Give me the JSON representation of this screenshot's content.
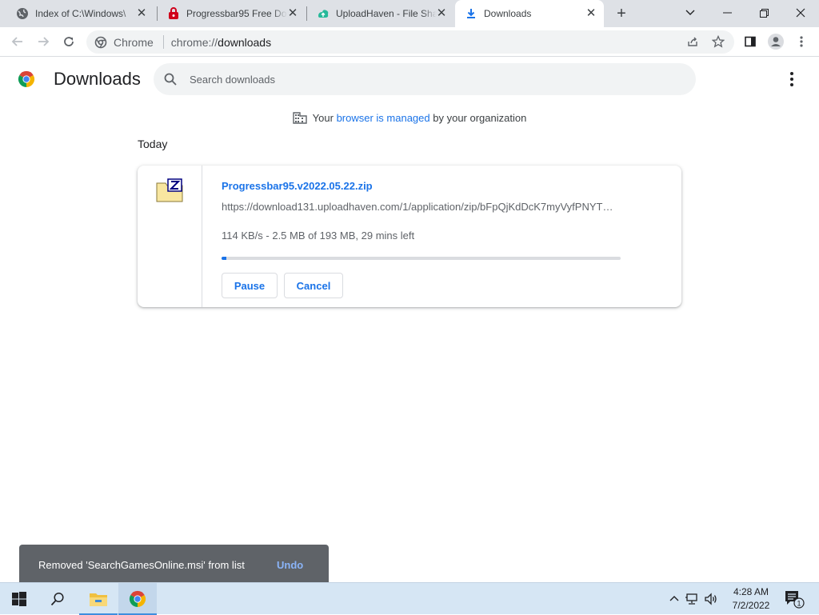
{
  "tabs": [
    {
      "title": "Index of C:\\Windows\\",
      "favicon": "globe-icon",
      "active": false
    },
    {
      "title": "Progressbar95 Free Do",
      "favicon": "progressbar95-icon",
      "active": false
    },
    {
      "title": "UploadHaven - File Sha",
      "favicon": "uploadhaven-icon",
      "active": false
    },
    {
      "title": "Downloads",
      "favicon": "download-icon",
      "active": true
    }
  ],
  "toolbar": {
    "site_name": "Chrome",
    "url_scheme": "chrome://",
    "url_host": "downloads"
  },
  "downloads": {
    "title": "Downloads",
    "search_placeholder": "Search downloads",
    "managed_prefix": "Your ",
    "managed_link": "browser is managed",
    "managed_suffix": " by your organization",
    "section_label": "Today",
    "item": {
      "file_name": "Progressbar95.v2022.05.22.zip",
      "url": "https://download131.uploadhaven.com/1/application/zip/bFpQjKdDcK7myVyfPNYT…",
      "status": "114 KB/s - 2.5 MB of 193 MB, 29 mins left",
      "progress_fraction": 0.013,
      "pause_label": "Pause",
      "cancel_label": "Cancel"
    }
  },
  "toast": {
    "message": "Removed 'SearchGamesOnline.msi' from list",
    "action": "Undo"
  },
  "taskbar": {
    "time": "4:28 AM",
    "date": "7/2/2022",
    "notification_count": "1"
  },
  "colors": {
    "accent": "#1a73e8",
    "tabstrip": "#dee1e6",
    "taskbar": "#d6e6f4",
    "toast": "#5f6368"
  }
}
